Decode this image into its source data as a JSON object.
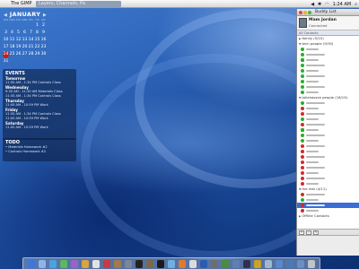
{
  "menubar": {
    "app_name": "The GIMP",
    "window_title": "Layers, Channels, Pa",
    "clock": "1:24 AM"
  },
  "calendar": {
    "month": "JANUARY",
    "weekdays": [
      "SUN",
      "MON",
      "TUE",
      "WED",
      "THU",
      "FRI",
      "SAT"
    ],
    "weeks": [
      [
        "",
        "",
        "",
        "",
        "",
        "1",
        "2"
      ],
      [
        "3",
        "4",
        "5",
        "6",
        "7",
        "8",
        "9"
      ],
      [
        "10",
        "11",
        "12",
        "13",
        "14",
        "15",
        "16"
      ],
      [
        "17",
        "18",
        "19",
        "20",
        "21",
        "22",
        "23"
      ],
      [
        "24",
        "25",
        "26",
        "27",
        "28",
        "29",
        "30"
      ],
      [
        "31",
        "",
        "",
        "",
        "",
        "",
        ""
      ]
    ],
    "today": "24"
  },
  "events": {
    "title": "EVENTS",
    "days": [
      {
        "day": "Tomorrow",
        "items": [
          "11:35 AM - 1:34 PM Controls Class"
        ]
      },
      {
        "day": "Wednesday",
        "items": [
          "9:30 AM - 11:30 AM Materials Class",
          "11:35 AM - 1:34 PM Controls Class"
        ]
      },
      {
        "day": "Thursday",
        "items": [
          "11:00 AM - 10:59 PM Work"
        ]
      },
      {
        "day": "Friday",
        "items": [
          "11:35 AM - 1:34 PM Controls Class",
          "11:00 AM - 10:59 PM Work"
        ]
      },
      {
        "day": "Saturday",
        "items": [
          "11:00 AM - 10:59 PM Work"
        ]
      }
    ]
  },
  "todo": {
    "title": "TODO",
    "items": [
      "Materials Homework #2",
      "Controls Homework #2"
    ]
  },
  "buddy_list": {
    "window_title": "Buddy List",
    "user_name": "Mam Jordan",
    "status": "Connected",
    "search_label": "All Contacts",
    "groups": [
      {
        "label": "family (5/10)",
        "contacts": []
      },
      {
        "label": "tech people (9/30)",
        "contacts": [
          "green",
          "green",
          "phone",
          "green",
          "green",
          "green",
          "green",
          "green",
          "green"
        ]
      },
      {
        "label": "tallahassee people (16/19)",
        "contacts": [
          "green",
          "red",
          "red",
          "green",
          "red",
          "phone",
          "green",
          "green",
          "red",
          "red",
          "red",
          "red",
          "red",
          "red",
          "red",
          "red"
        ]
      },
      {
        "label": "the rest (4/11)",
        "contacts": [
          "red",
          "green",
          "red",
          "red"
        ]
      }
    ],
    "offline_label": "Offline Contacts"
  },
  "dock": {
    "icons": [
      "finder-icon",
      "mail-icon",
      "safari-icon",
      "ichat-icon",
      "itunes-icon",
      "iphoto-icon",
      "imovie-icon",
      "ical-icon",
      "addressbook-icon",
      "preferences-icon",
      "terminal-icon",
      "gimp-icon",
      "x11-icon",
      "adium-icon",
      "firefox-icon",
      "textedit-icon",
      "quicktime-icon",
      "dictionary-icon",
      "activity-icon",
      "network-icon",
      "dashboard-icon",
      "sherlock-icon",
      "preview-icon",
      "folder-icon",
      "downloads-icon",
      "applications-icon",
      "trash-icon"
    ]
  },
  "colors": {
    "today_marker": "#c02020",
    "online": "#2dae2d",
    "away": "#d42a2a",
    "selection": "#3a6ed6"
  }
}
